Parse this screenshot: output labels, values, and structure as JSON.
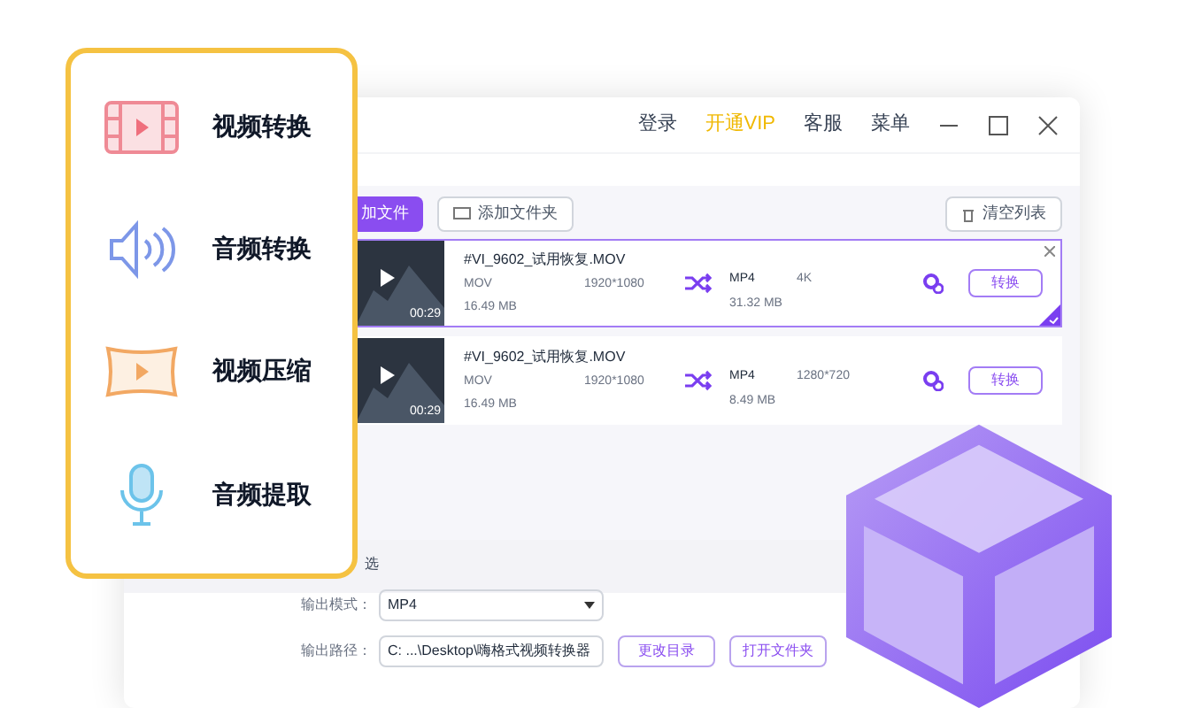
{
  "window": {
    "menu": [
      {
        "label": "登录",
        "kind": "normal"
      },
      {
        "label": "开通VIP",
        "kind": "vip"
      },
      {
        "label": "客服",
        "kind": "normal"
      },
      {
        "label": "菜单",
        "kind": "normal"
      }
    ]
  },
  "toolbar": {
    "add_file": "加文件",
    "add_folder": "添加文件夹",
    "clear_list": "清空列表"
  },
  "files": [
    {
      "name": "#VI_9602_试用恢复.MOV",
      "selected": true,
      "duration": "00:29",
      "format": "MOV",
      "resolution": "1920*1080",
      "size": "16.49 MB",
      "out_format": "MP4",
      "out_resolution": "4K",
      "out_size": "31.32 MB",
      "button": "转换"
    },
    {
      "name": "#VI_9602_试用恢复.MOV",
      "selected": false,
      "duration": "00:29",
      "format": "MOV",
      "resolution": "1920*1080",
      "size": "16.49 MB",
      "out_format": "MP4",
      "out_resolution": "1280*720",
      "out_size": "8.49 MB",
      "button": "转换"
    }
  ],
  "output": {
    "section_label": "选",
    "mode_label": "输出模式：",
    "mode_value": "MP4",
    "path_label": "输出路径：",
    "path_value": "C: ...\\Desktop\\嗨格式视频转换器",
    "buttons": [
      "更改目录",
      "打开文件夹"
    ]
  },
  "feature_menu": [
    {
      "label": "视频转换",
      "kind": "video"
    },
    {
      "label": "音频转换",
      "kind": "audio"
    },
    {
      "label": "视频压缩",
      "kind": "compress"
    },
    {
      "label": "音频提取",
      "kind": "extract"
    }
  ]
}
